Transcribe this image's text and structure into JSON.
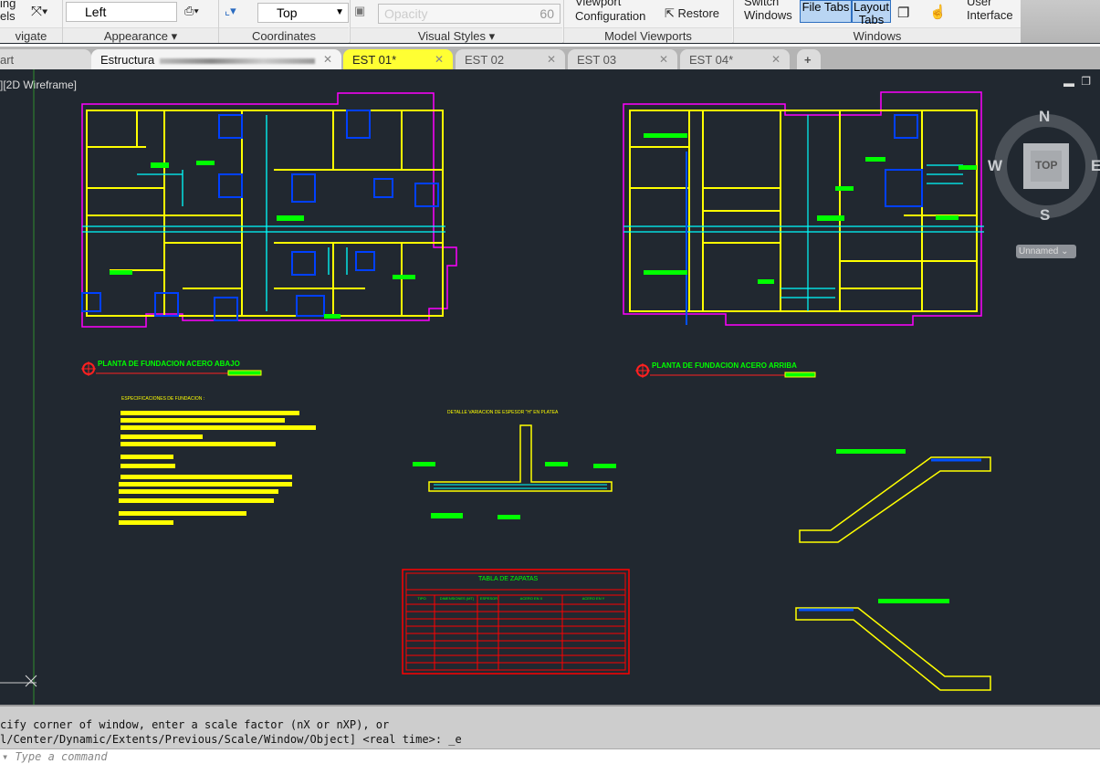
{
  "ribbon": {
    "navigate_top": "ing",
    "navigate_bottom": "els",
    "navigate_label": "vigate",
    "view_left": "Left",
    "appearance_label": "Appearance",
    "coords_view": "Top",
    "coordinates_label": "Coordinates",
    "opacity_placeholder": "Opacity",
    "opacity_value": "60",
    "visual_styles_label": "Visual Styles",
    "viewport_config_top": "Viewport",
    "viewport_config_bottom": "Configuration",
    "restore": "Restore",
    "model_viewports_label": "Model Viewports",
    "switch_windows_top": "Switch",
    "switch_windows_bottom": "Windows",
    "file_tabs": "File Tabs",
    "layout_tabs_top": "Layout",
    "layout_tabs_bottom": "Tabs",
    "user_interface_top": "User",
    "user_interface_bottom": "Interface",
    "windows_label": "Windows"
  },
  "tabs": [
    {
      "label": "art"
    },
    {
      "label": "Estructura"
    },
    {
      "label": "EST 01*"
    },
    {
      "label": "EST 02"
    },
    {
      "label": "EST 03"
    },
    {
      "label": "EST 04*"
    }
  ],
  "viewport": {
    "label": "][2D Wireframe]",
    "viewcube": {
      "n": "N",
      "s": "S",
      "e": "E",
      "w": "W",
      "face": "TOP",
      "ucs": "Unnamed"
    }
  },
  "drawing": {
    "title_left": "PLANTA DE FUNDACION ACERO ABAJO",
    "title_right": "PLANTA DE FUNDACION ACERO ARRIBA",
    "specs_title": "ESPECIFICACIONES DE FUNDACION :",
    "detail_title": "DETALLE VARIACION DE ESPESOR \"H\" EN   PLATEA",
    "table_title": "TABLA DE ZAPATAS",
    "table_headers": [
      "TIPO",
      "DIMENSIONES (MT)",
      "ESPESOR",
      "ACERO EN X",
      "ACERO EN Y"
    ]
  },
  "command": {
    "line1": "cify corner of window, enter a scale factor (nX or nXP), or",
    "line2": "l/Center/Dynamic/Extents/Previous/Scale/Window/Object] <real time>: _e",
    "placeholder": "Type a command"
  },
  "colors": {
    "background": "#212830",
    "walls": "#ffff00",
    "outline": "#ff00ff",
    "rebar": "#00ffff",
    "labels": "#00ff00",
    "table": "#ff0000",
    "active_tab": "#ffff33"
  }
}
